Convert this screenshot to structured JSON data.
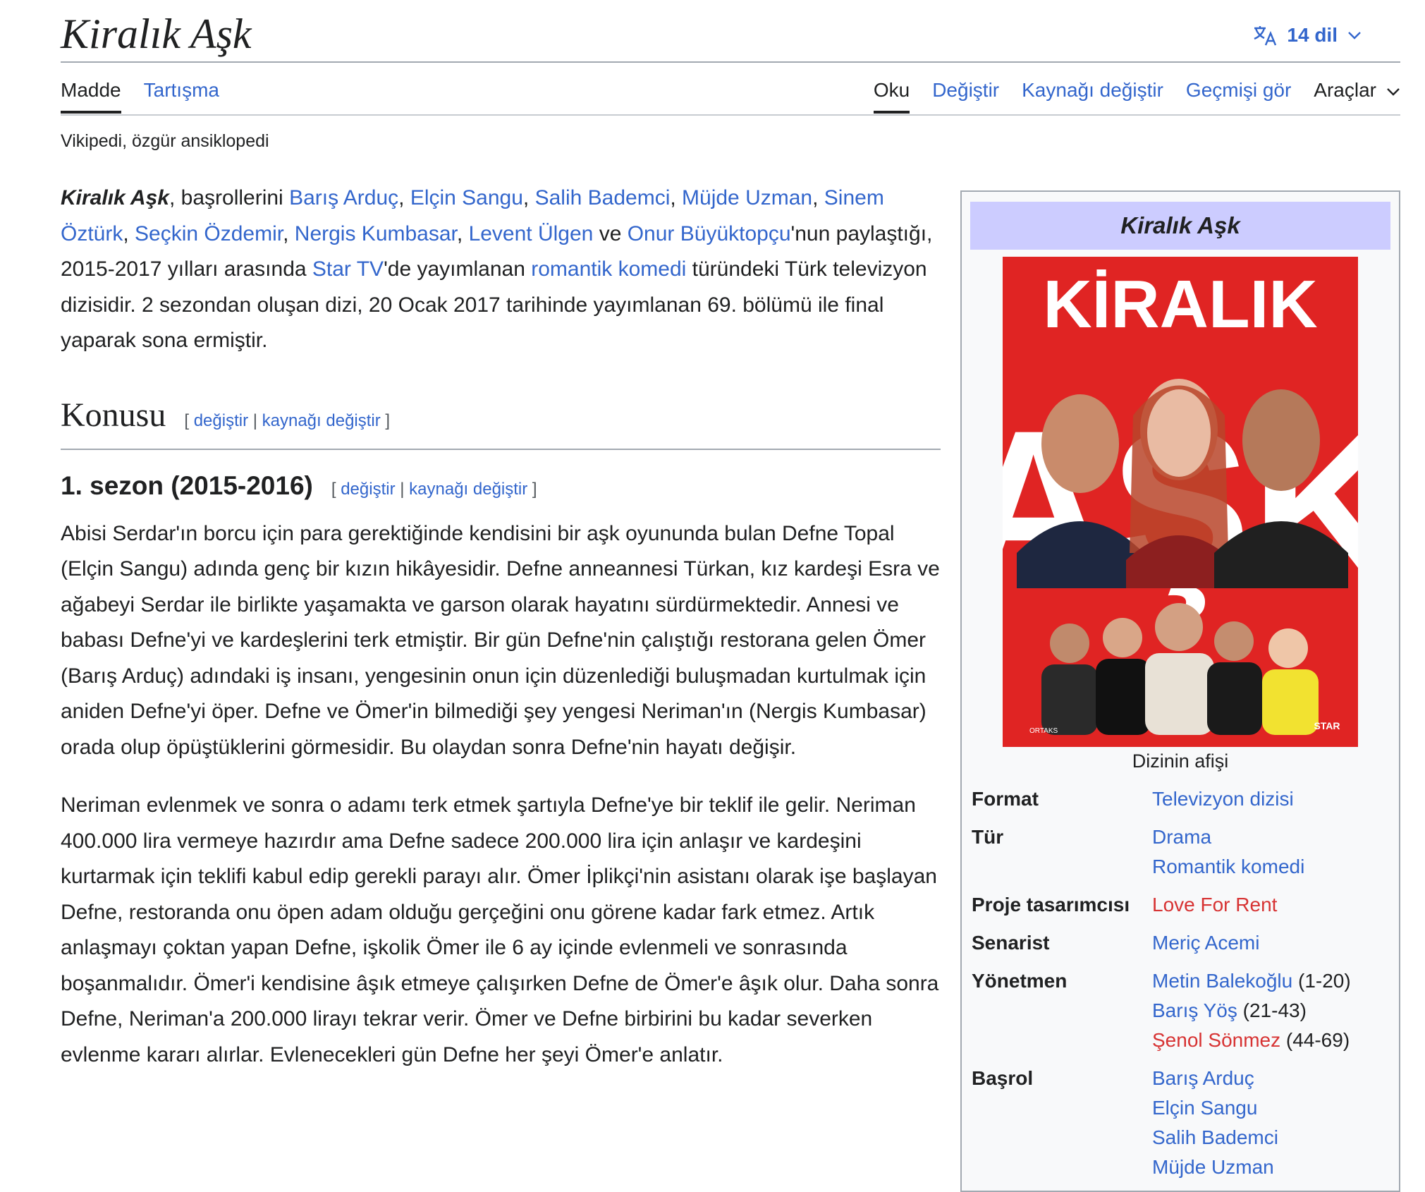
{
  "page": {
    "title": "Kiralık Aşk",
    "language_button": "14 dil",
    "tagline": "Vikipedi, özgür ansiklopedi"
  },
  "tabs": {
    "left": [
      "Madde",
      "Tartışma"
    ],
    "right": [
      "Oku",
      "Değiştir",
      "Kaynağı değiştir",
      "Geçmişi gör",
      "Araçlar"
    ]
  },
  "edit_links": {
    "open": "[",
    "edit": "değiştir",
    "sep": "|",
    "source": "kaynağı değiştir",
    "close": "]"
  },
  "intro": {
    "title_bold": "Kiralık Aşk",
    "t1": ", başrollerini ",
    "actors": [
      "Barış Arduç",
      "Elçin Sangu",
      "Salih Bademci",
      "Müjde Uzman",
      "Sinem Öztürk",
      "Seçkin Özdemir",
      "Nergis Kumbasar",
      "Levent Ülgen",
      "Onur Büyüktopçu"
    ],
    "comma": ", ",
    "ve": " ve ",
    "t2": "'nun paylaştığı, 2015-2017 yılları arasında ",
    "channel": "Star TV",
    "t3": "'de yayımlanan ",
    "genre": "romantik komedi",
    "t4": " türündeki Türk televizyon dizisidir. 2 sezondan oluşan dizi, 20 Ocak 2017 tarihinde yayımlanan 69. bölümü ile final yaparak sona ermiştir."
  },
  "section": {
    "heading": "Konusu",
    "subheading": "1. sezon (2015-2016)",
    "paragraphs": [
      "Abisi Serdar'ın borcu için para gerektiğinde kendisini bir aşk oyununda bulan Defne Topal (Elçin Sangu) adında genç bir kızın hikâyesidir. Defne anneannesi Türkan, kız kardeşi Esra ve ağabeyi Serdar ile birlikte yaşamakta ve garson olarak hayatını sürdürmektedir. Annesi ve babası Defne'yi ve kardeşlerini terk etmiştir. Bir gün Defne'nin çalıştığı restorana gelen Ömer (Barış Arduç) adındaki iş insanı, yengesinin onun için düzenlediği buluşmadan kurtulmak için aniden Defne'yi öper. Defne ve Ömer'in bilmediği şey yengesi Neriman'ın (Nergis Kumbasar) orada olup öpüştüklerini görmesidir. Bu olaydan sonra Defne'nin hayatı değişir.",
      "Neriman evlenmek ve sonra o adamı terk etmek şartıyla Defne'ye bir teklif ile gelir. Neriman 400.000 lira vermeye hazırdır ama Defne sadece 200.000 lira için anlaşır ve kardeşini kurtarmak için teklifi kabul edip gerekli parayı alır. Ömer İplikçi'nin asistanı olarak işe başlayan Defne, restoranda onu öpen adam olduğu gerçeğini onu görene kadar fark etmez. Artık anlaşmayı çoktan yapan Defne, işkolik Ömer ile 6 ay içinde evlenmeli ve sonrasında boşanmalıdır. Ömer'i kendisine âşık etmeye çalışırken Defne de Ömer'e âşık olur. Daha sonra Defne, Neriman'a 200.000 lirayı tekrar verir. Ömer ve Defne birbirini bu kadar severken evlenme kararı alırlar. Evlenecekleri gün Defne her şeyi Ömer'e anlatır."
    ]
  },
  "infobox": {
    "title": "Kiralık Aşk",
    "poster": {
      "top": "KİRALIK",
      "main": "AŞK",
      "logo": "STAR",
      "left_logo": "ORTAKS"
    },
    "caption": "Dizinin afişi",
    "rows": {
      "format": {
        "label": "Format",
        "values": [
          "Televizyon dizisi"
        ]
      },
      "genre": {
        "label": "Tür",
        "values": [
          "Drama",
          "Romantik komedi"
        ]
      },
      "creator": {
        "label": "Proje tasarımcısı",
        "values": [
          "Love For Rent"
        ]
      },
      "writer": {
        "label": "Senarist",
        "values": [
          "Meriç Acemi"
        ]
      },
      "director": {
        "label": "Yönetmen",
        "values": [
          "Metin Balekoğlu",
          "Barış Yöş",
          "Şenol Sönmez"
        ],
        "episodes": [
          "(1-20)",
          "(21-43)",
          "(44-69)"
        ]
      },
      "starring": {
        "label": "Başrol",
        "values": [
          "Barış Arduç",
          "Elçin Sangu",
          "Salih Bademci",
          "Müjde Uzman"
        ]
      }
    }
  },
  "colors": {
    "link": "#3366cc",
    "redlink": "#d73333",
    "infobox_title_bg": "#ccccff",
    "poster_red": "#e02423"
  }
}
